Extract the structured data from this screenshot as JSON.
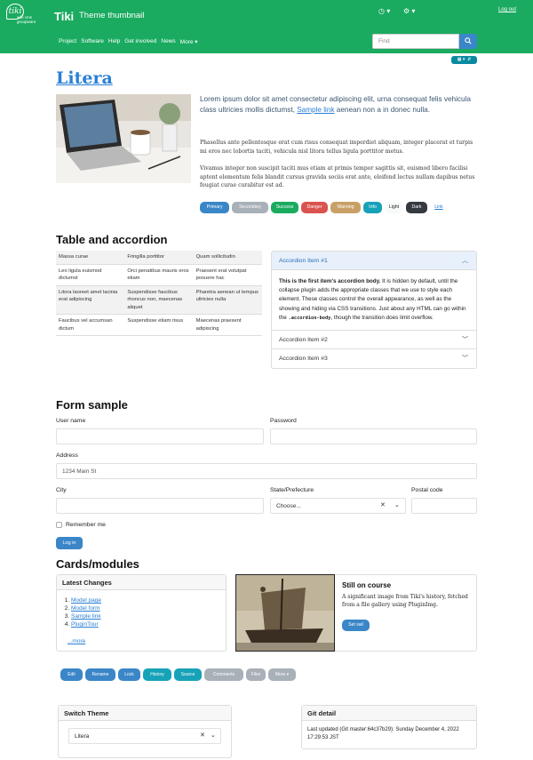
{
  "header": {
    "logo_text": "tiki",
    "logo_subtext": "wiki cms groupware",
    "site_title": "Tiki",
    "site_subtitle": "Theme thumbnail",
    "logout_label": "Log out",
    "nav_items": [
      "Project",
      "Software",
      "Help",
      "Get involved",
      "News",
      "More"
    ],
    "search_placeholder": "Find"
  },
  "intro": {
    "title": "Litera",
    "lead_before": "Lorem ipsum dolor sit amet consectetur adipiscing elit, urna consequat felis vehicula class ultricies mollis dictumst, ",
    "lead_link": "Sample link",
    "lead_after": " aenean non a in donec nulla.",
    "para1": "Phasellus ante pellentesque erat cum risus consequat imperdiet aliquam, integer placerat et turpis mi eros nec lobortis taciti, vehicula nisl litora tellus ligula porttitor metus.",
    "para2": "Vivamus integer non suscipit taciti mus etiam at primis tempor sagittis sit, euismod libero facilisi aptent elementum felis blandit cursus gravida sociis erat ante, eleifend lectus nullam dapibus netus feugiat curae curabitur est ad.",
    "buttons": [
      {
        "label": "Primary",
        "color": "#3a86c8"
      },
      {
        "label": "Secondary",
        "color": "#a8b0b8"
      },
      {
        "label": "Success",
        "color": "#1aab60"
      },
      {
        "label": "Danger",
        "color": "#d9534f"
      },
      {
        "label": "Warning",
        "color": "#c8a067"
      },
      {
        "label": "Info",
        "color": "#17a2b8"
      },
      {
        "label": "Light",
        "color": "#f8f9fa"
      },
      {
        "label": "Dark",
        "color": "#343a40"
      },
      {
        "label": "Link",
        "color": "#ffffff"
      }
    ]
  },
  "table_section": {
    "heading": "Table and accordion",
    "rows": [
      [
        "Massa curae",
        "Fringilla porttitor",
        "Quam sollicitudin"
      ],
      [
        "Leo ligula euismod dictumst",
        "Orci penatibus mauris eros etiam",
        "Praesent erat volutpat posuere hac"
      ],
      [
        "Litora laoreet amet lacinia erat adipiscing",
        "Suspendisse faucibus rhoncus non, maecenas aliquet",
        "Pharetra aenean ut tempus ultricies nulla"
      ],
      [
        "Faucibus vel accumsan dictum",
        "Suspendisse etiam risus",
        "Maecenas praesent adipiscing"
      ]
    ],
    "accordion": {
      "item1": "Accordion Item #1",
      "body_bold": "This is the first item's accordion body.",
      "body_text1": " It is hidden by default, until the collapse plugin adds the appropriate classes that we use to style each element. These classes control the overall appearance, as well as the showing and hiding via CSS transitions. Just about any HTML can go within the ",
      "body_code": ".accordion-body",
      "body_text2": ", though the transition does limit overflow.",
      "item2": "Accordion Item #2",
      "item3": "Accordion Item #3"
    }
  },
  "form": {
    "heading": "Form sample",
    "username_label": "User name",
    "password_label": "Password",
    "address_label": "Address",
    "address_placeholder": "1234 Main St",
    "city_label": "City",
    "state_label": "State/Prefecture",
    "state_value": "Choose...",
    "postal_label": "Postal code",
    "remember_label": "Remember me",
    "login_label": "Log in"
  },
  "cards": {
    "heading": "Cards/modules",
    "latest_title": "Latest Changes",
    "latest_items": [
      "Model page",
      "Model form",
      "Sample link",
      "PluginTour"
    ],
    "more_label": "...more",
    "still_title": "Still on course",
    "still_text": "A significant image from Tiki's history, fetched from a file gallery using PluginImg.",
    "set_sail_label": "Set sail"
  },
  "actions": [
    {
      "label": "Edit",
      "color": "#3a86c8"
    },
    {
      "label": "Rename",
      "color": "#3a86c8"
    },
    {
      "label": "Lock",
      "color": "#3a86c8"
    },
    {
      "label": "History",
      "color": "#17a2b8"
    },
    {
      "label": "Source",
      "color": "#17a2b8"
    },
    {
      "label": "Comments",
      "color": "#a8b0b8"
    },
    {
      "label": "Files",
      "color": "#a8b0b8"
    },
    {
      "label": "More",
      "color": "#a8b0b8"
    }
  ],
  "switch_theme": {
    "title": "Switch Theme",
    "value": "Litera"
  },
  "git": {
    "title": "Git detail",
    "text": "Last updated (Git master:64c37b29): Sunday December 4, 2022 17:29:53 JST"
  }
}
